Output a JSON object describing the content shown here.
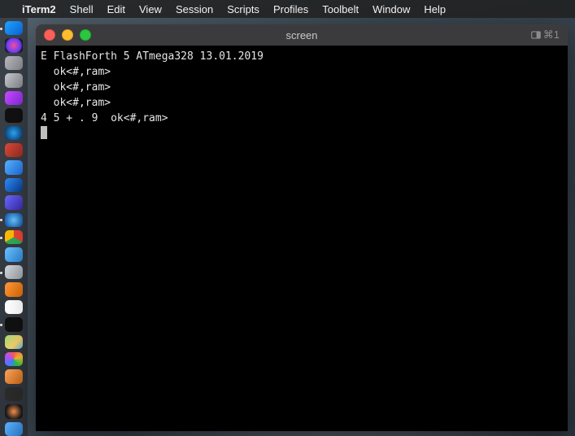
{
  "menubar": {
    "apple": "",
    "app": "iTerm2",
    "items": [
      "Shell",
      "Edit",
      "View",
      "Session",
      "Scripts",
      "Profiles",
      "Toolbelt",
      "Window",
      "Help"
    ]
  },
  "dock": {
    "items": [
      {
        "name": "finder-icon",
        "bg": "linear-gradient(135deg,#1fa4ff,#0b65d6)",
        "running": true
      },
      {
        "name": "siri-icon",
        "bg": "radial-gradient(circle at 50% 50%, #ff4fa3, #6a40ff 60%, #111 80%)",
        "running": false
      },
      {
        "name": "launchpad-icon",
        "bg": "linear-gradient(135deg,#b8b8be,#8a8a93)",
        "running": false
      },
      {
        "name": "system-prefs-icon",
        "bg": "linear-gradient(135deg,#c9c9cf,#888890)",
        "running": false
      },
      {
        "name": "podcasts-icon",
        "bg": "linear-gradient(135deg,#c84bff,#8a2be2)",
        "running": false
      },
      {
        "name": "appletv-icon",
        "bg": "#111",
        "running": false
      },
      {
        "name": "safari-dev-icon",
        "bg": "radial-gradient(circle,#2aa9ff,#0a2a55)",
        "running": false
      },
      {
        "name": "dictionary-icon",
        "bg": "linear-gradient(135deg,#d94a3c,#9c2c22)",
        "running": false
      },
      {
        "name": "mail-icon",
        "bg": "linear-gradient(135deg,#58b3ff,#1e6fe0)",
        "running": false
      },
      {
        "name": "xcode-icon",
        "bg": "linear-gradient(135deg,#2c8fff,#0a3a8a)",
        "running": false
      },
      {
        "name": "app1-icon",
        "bg": "linear-gradient(135deg,#6a6aff,#3a2aaa)",
        "running": false
      },
      {
        "name": "safari-icon",
        "bg": "radial-gradient(circle,#6ac6ff,#0a4aa0)",
        "running": true
      },
      {
        "name": "chrome-icon",
        "bg": "conic-gradient(#ea4335 0 120deg,#34a853 120deg 240deg,#fbbc05 240deg 360deg)",
        "running": true
      },
      {
        "name": "folder-blue-icon",
        "bg": "linear-gradient(135deg,#6ec2ff,#2a88d8)",
        "running": false
      },
      {
        "name": "preview-icon",
        "bg": "linear-gradient(135deg,#d7dbe0,#9aa0a6)",
        "running": true
      },
      {
        "name": "calculator-icon",
        "bg": "linear-gradient(135deg,#ff9a3c,#e06a00)",
        "running": false
      },
      {
        "name": "calendar-icon",
        "bg": "#fff",
        "running": false
      },
      {
        "name": "iterm2-icon",
        "bg": "#111",
        "running": true
      },
      {
        "name": "maps-icon",
        "bg": "linear-gradient(135deg,#9edc7a,#f7d36a 60%, #6ab8e8)",
        "running": false
      },
      {
        "name": "color-app-icon",
        "bg": "conic-gradient(#ff5f57,#febc2e,#28c840,#3a86ff,#b052ff,#ff5f57)",
        "running": false
      },
      {
        "name": "app2-icon",
        "bg": "linear-gradient(135deg,#ffa35a,#c96a1a)",
        "running": false
      },
      {
        "name": "app3-icon",
        "bg": "#2b2b2c",
        "running": false
      },
      {
        "name": "spark-icon",
        "bg": "radial-gradient(circle,#ff944d,#1a1a1a 70%)",
        "running": false
      },
      {
        "name": "folder-icon",
        "bg": "linear-gradient(135deg,#5fb4ff,#2a78c8)",
        "running": false
      }
    ]
  },
  "window": {
    "title": "screen",
    "shortcut": "⌘1"
  },
  "terminal": {
    "lines": [
      "E FlashForth 5 ATmega328 13.01.2019",
      "",
      "  ok<#,ram>",
      "  ok<#,ram>",
      "  ok<#,ram>",
      "4 5 + . 9  ok<#,ram>"
    ]
  }
}
